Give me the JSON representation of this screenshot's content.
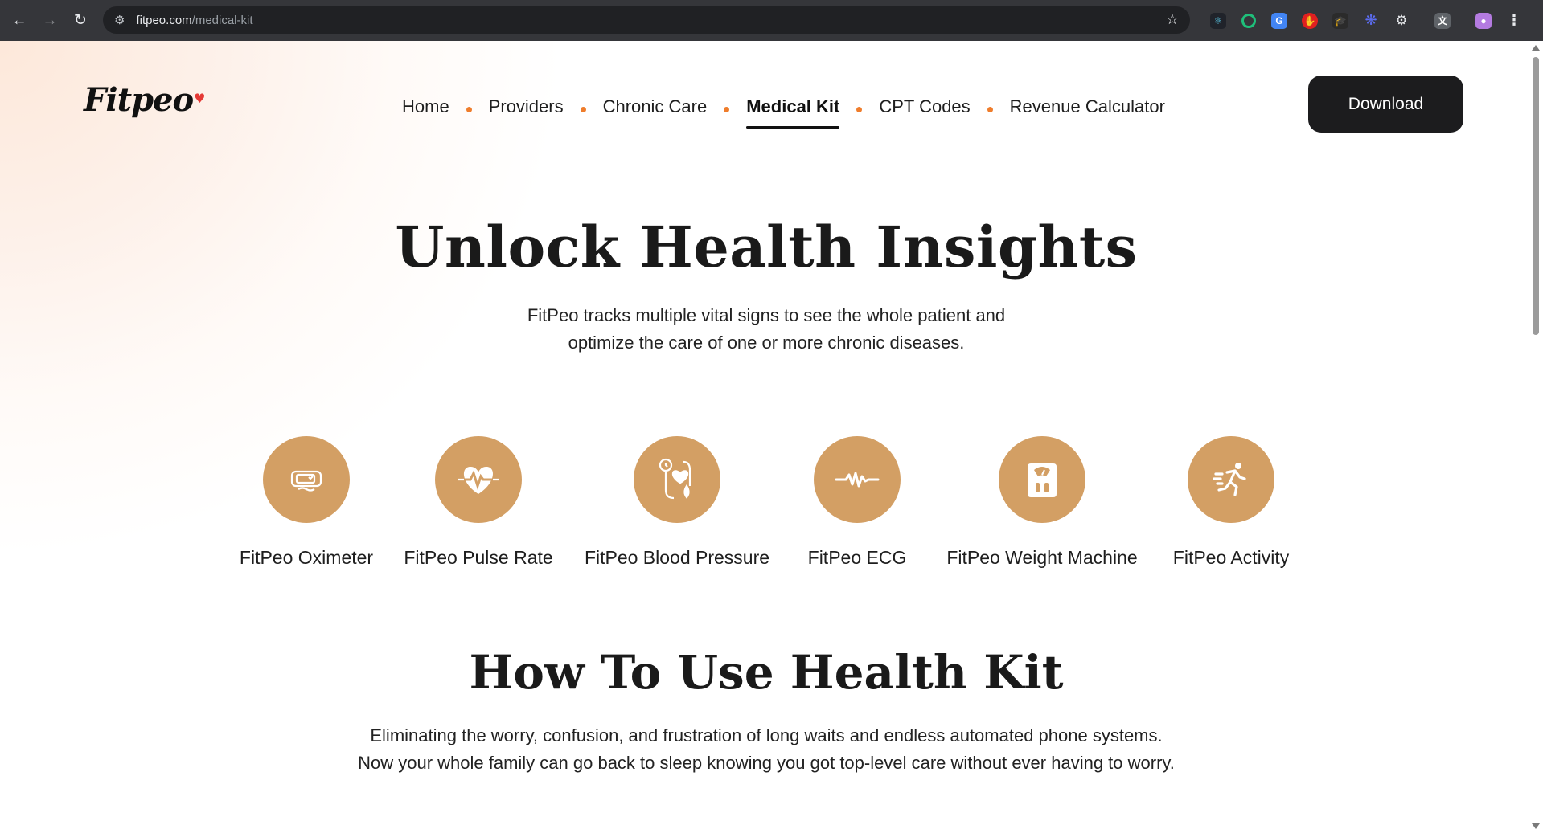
{
  "browser": {
    "url_domain": "fitpeo.com",
    "url_path": "/medical-kit"
  },
  "brand": {
    "logo_text": "Fitpeo",
    "accent_color": "#ef7d2c",
    "icon_color": "#d39f64"
  },
  "nav": {
    "items": [
      {
        "label": "Home"
      },
      {
        "label": "Providers"
      },
      {
        "label": "Chronic Care"
      },
      {
        "label": "Medical Kit",
        "active": true
      },
      {
        "label": "CPT Codes"
      },
      {
        "label": "Revenue Calculator"
      }
    ],
    "download_label": "Download"
  },
  "hero": {
    "title": "Unlock Health Insights",
    "subtitle_line1": "FitPeo tracks multiple vital signs to see the whole patient and",
    "subtitle_line2": "optimize the care of one or more chronic diseases."
  },
  "kit": [
    {
      "label": "FitPeo Oximeter",
      "icon": "oximeter-icon"
    },
    {
      "label": "FitPeo Pulse Rate",
      "icon": "heart-pulse-icon"
    },
    {
      "label": "FitPeo Blood Pressure",
      "icon": "blood-pressure-icon"
    },
    {
      "label": "FitPeo ECG",
      "icon": "ecg-wave-icon"
    },
    {
      "label": "FitPeo Weight Machine",
      "icon": "weight-scale-icon"
    },
    {
      "label": "FitPeo Activity",
      "icon": "running-icon"
    }
  ],
  "how_to": {
    "title": "How To Use Health Kit",
    "line1": "Eliminating the worry, confusion, and frustration of long waits and endless automated phone systems.",
    "line2": "Now your whole family can go back to sleep knowing you got top-level care without ever having to worry."
  }
}
